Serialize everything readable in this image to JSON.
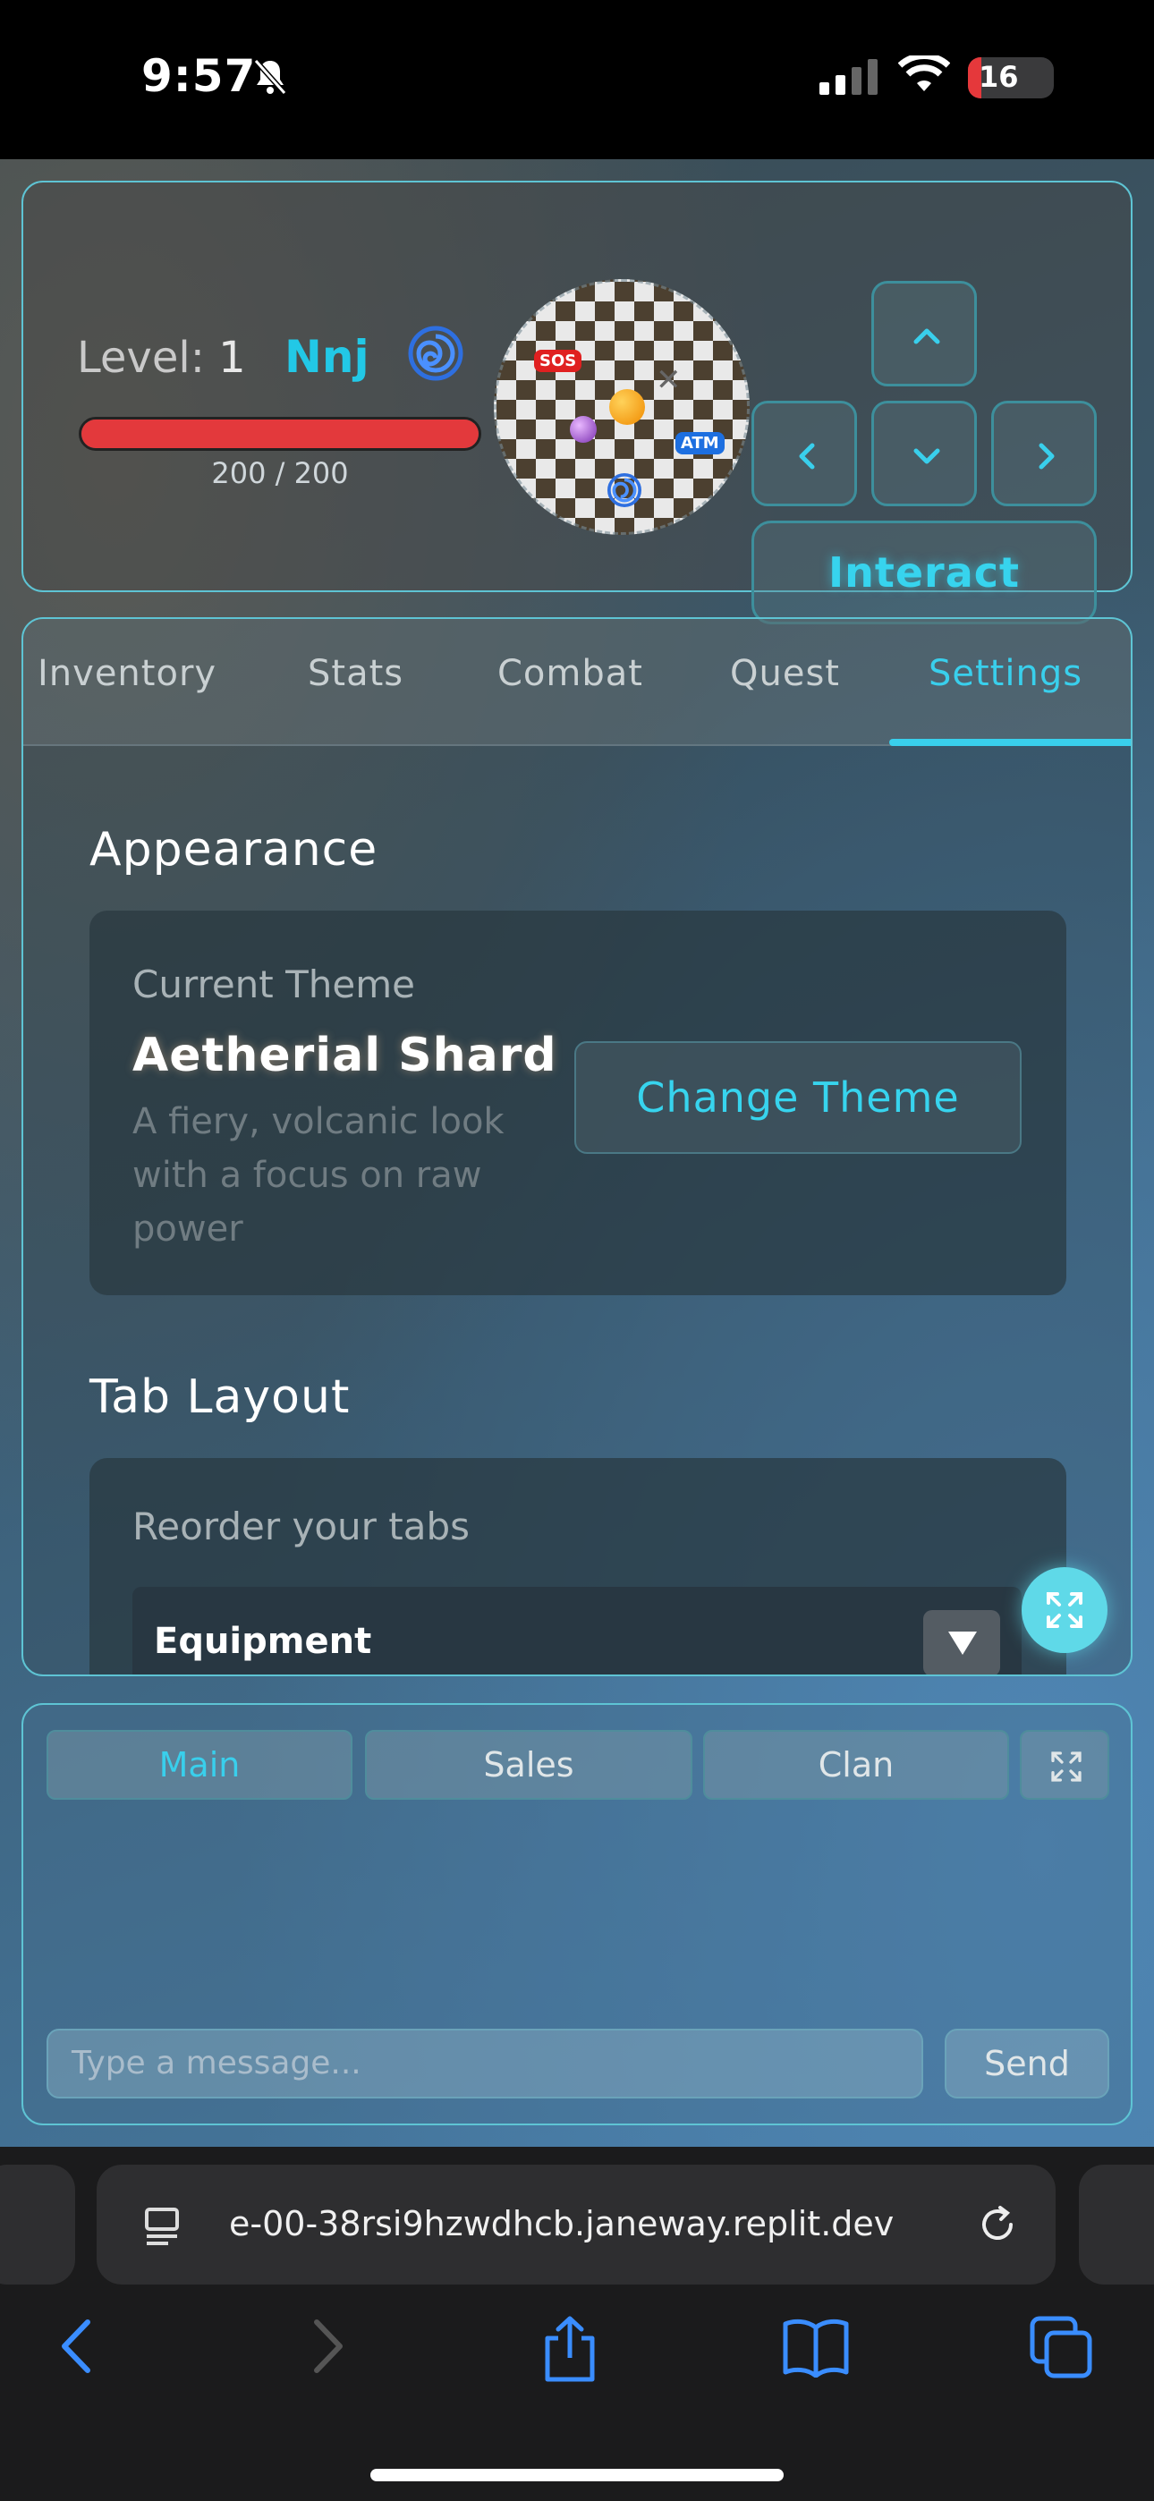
{
  "status_bar": {
    "time": "9:57",
    "battery": "16"
  },
  "hud": {
    "level_label": "Level:",
    "level_value": "1",
    "player_name": "Nnj",
    "hp_text": "200 / 200",
    "hp_fraction": 1.0,
    "map_markers": {
      "sos": "SOS",
      "atm": "ATM"
    },
    "interact_label": "Interact"
  },
  "tabs": [
    {
      "label": "Inventory"
    },
    {
      "label": "Stats"
    },
    {
      "label": "Combat"
    },
    {
      "label": "Quest"
    },
    {
      "label": "Settings",
      "active": true
    }
  ],
  "settings": {
    "appearance": {
      "heading": "Appearance",
      "current_label": "Current Theme",
      "theme_name": "Aetherial Shard",
      "theme_desc": "A fiery, volcanic look with a focus on raw power",
      "change_button": "Change Theme"
    },
    "tab_layout": {
      "heading": "Tab Layout",
      "reorder_label": "Reorder your tabs",
      "selected": "Equipment"
    }
  },
  "chat": {
    "tabs": [
      {
        "label": "Main",
        "active": true
      },
      {
        "label": "Sales"
      },
      {
        "label": "Clan"
      }
    ],
    "placeholder": "Type a message...",
    "send_label": "Send"
  },
  "browser": {
    "url": "e-00-38rsi9hzwdhcb.janeway.replit.dev"
  },
  "colors": {
    "accent": "#39cfec",
    "hp": "#e3393c",
    "panel_border": "#5ec4d4"
  }
}
